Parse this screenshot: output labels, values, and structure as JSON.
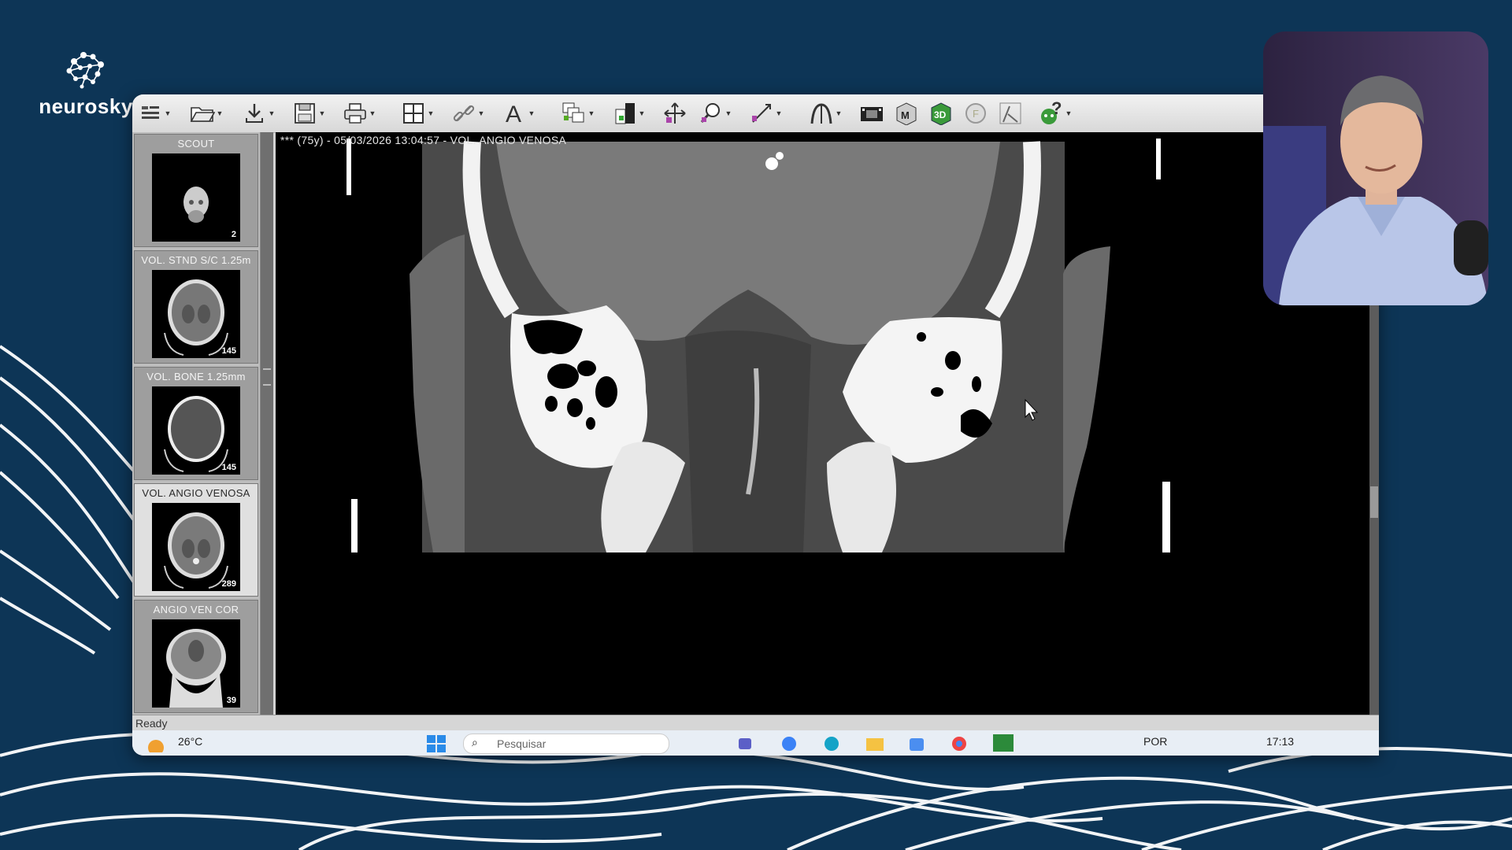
{
  "brand": {
    "name": "neurosky"
  },
  "toolbar": {
    "icons": [
      "menu-icon",
      "open-folder-icon",
      "download-icon",
      "save-icon",
      "print-icon",
      "layout-grid-icon",
      "link-icon",
      "text-annotation-icon",
      "copy-series-icon",
      "window-level-icon",
      "pan-icon",
      "zoom-icon",
      "measure-icon",
      "reference-lines-icon",
      "cine-icon",
      "mpr-icon",
      "3d-icon",
      "fusion-icon",
      "curved-mpr-icon",
      "help-icon"
    ]
  },
  "sidebar": {
    "series": [
      {
        "label": "SCOUT",
        "count": "2",
        "selected": false
      },
      {
        "label": "VOL. STND S/C 1.25m",
        "count": "145",
        "selected": false
      },
      {
        "label": "VOL. BONE  1.25mm",
        "count": "145",
        "selected": false
      },
      {
        "label": "VOL. ANGIO VENOSA",
        "count": "289",
        "selected": true
      },
      {
        "label": "ANGIO VEN COR",
        "count": "39",
        "selected": false
      }
    ]
  },
  "viewer": {
    "title": "*** (75y) - 05/03/2026 13:04:57 - VOL. ANGIO VENOSA"
  },
  "status": {
    "text": "Ready"
  },
  "taskbar": {
    "weather": "26°C",
    "search_placeholder": "Pesquisar",
    "language": "POR",
    "time": "17:13"
  },
  "colors": {
    "background": "#0d3556",
    "toolbar": "#e6e6e6",
    "selected_series": "#e0e0e0"
  }
}
